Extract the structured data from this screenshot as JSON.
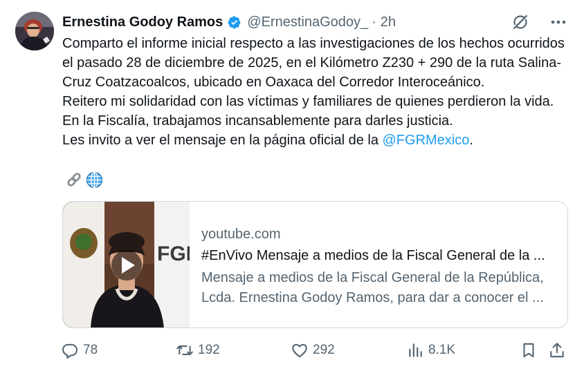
{
  "author": {
    "name": "Ernestina Godoy Ramos",
    "handle": "@ErnestinaGodoy_",
    "separator": "·",
    "time": "2h"
  },
  "tweet": {
    "paragraph1": "Comparto el informe inicial respecto a las investigaciones de los hechos ocurridos el pasado 28 de diciembre de 2025, en el Kilómetro Z230 + 290 de la ruta Salina-Cruz Coatzacoalcos, ubicado en Oaxaca del Corredor Interoceánico.",
    "paragraph2": "Reitero mi solidaridad con las víctimas y familiares de quienes perdieron la vida. En la Fiscalía, trabajamos incansablemente para darles justicia.",
    "paragraph3_before": "Les invito a ver el mensaje en la página oficial de la ",
    "mention": "@FGRMexico",
    "paragraph3_after": ".",
    "emojis": [
      "link-emoji",
      "globe-emoji"
    ]
  },
  "card": {
    "domain": "youtube.com",
    "title": "#EnVivo Mensaje a medios de la Fiscal General de la ...",
    "desc_line1": "Mensaje a medios de la Fiscal General de la República,",
    "desc_line2": "Lcda. Ernestina Godoy Ramos, para dar a conocer el ...",
    "thumb_text": "FGR"
  },
  "actions": {
    "replies": "78",
    "reposts": "192",
    "likes": "292",
    "views": "8.1K"
  },
  "colors": {
    "accent": "#1d9bf0",
    "text": "#0f1419",
    "secondary": "#536471",
    "border": "#cfd9de"
  }
}
